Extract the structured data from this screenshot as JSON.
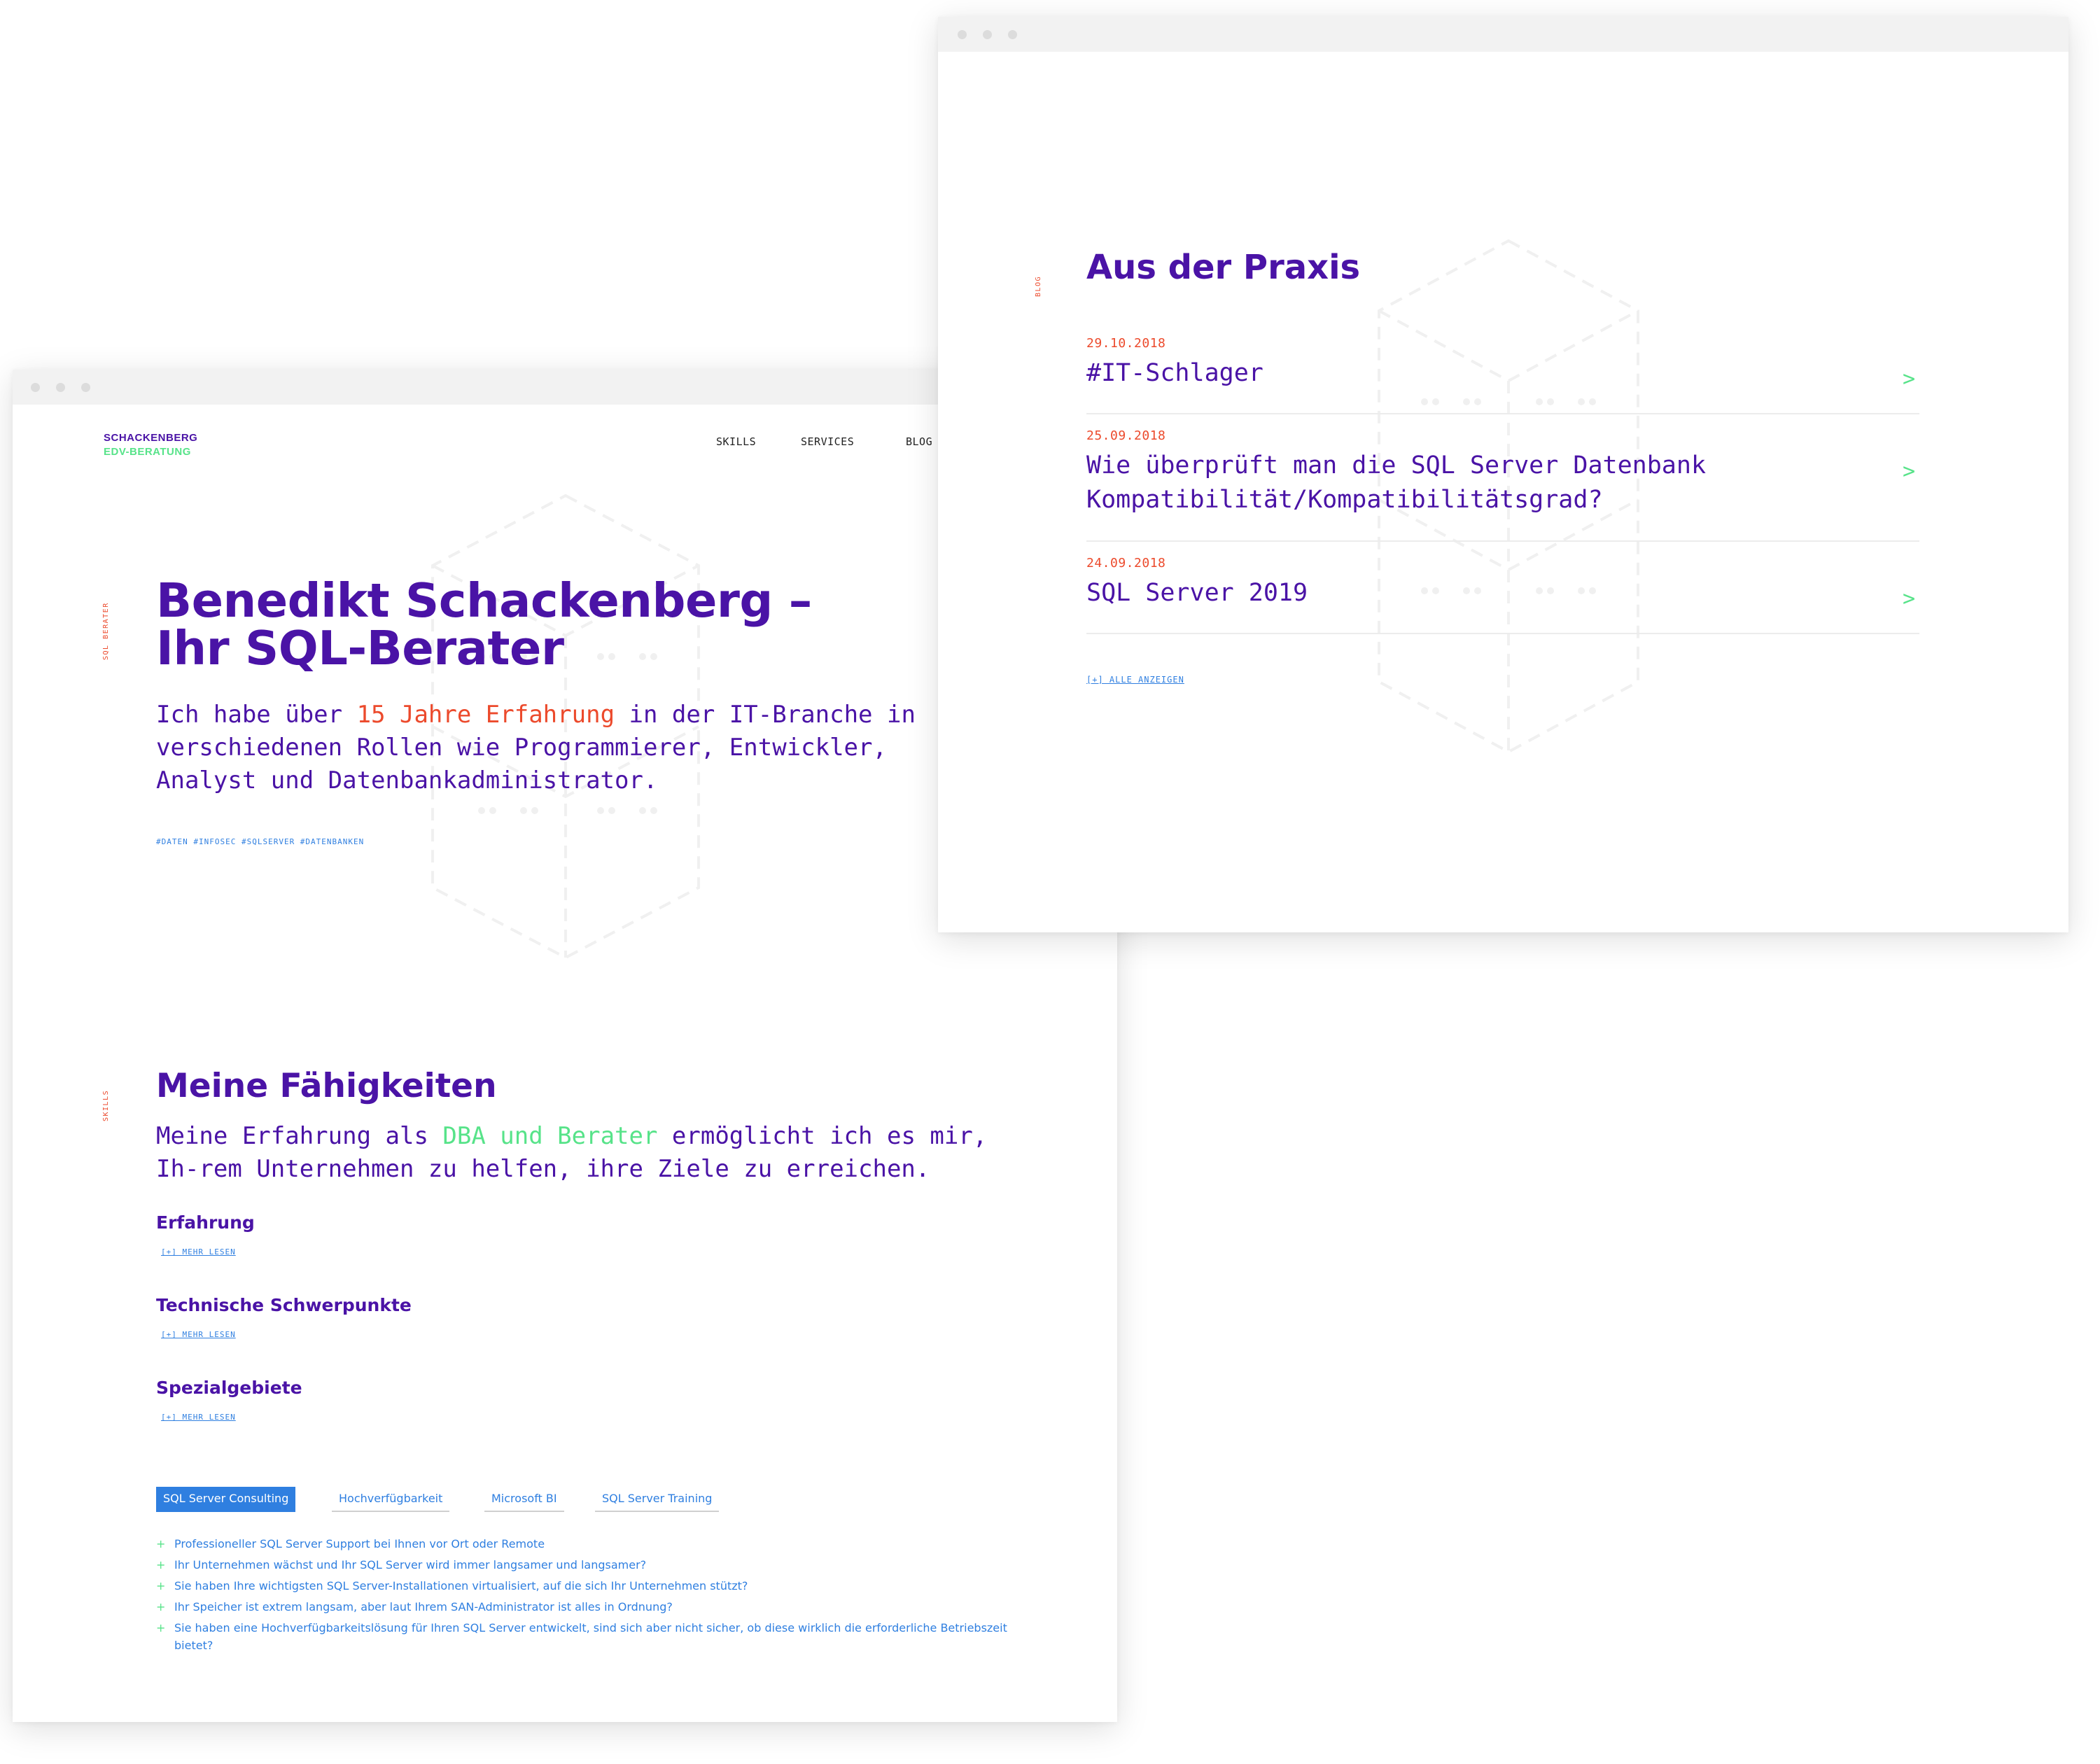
{
  "colors": {
    "purple": "#4a13a6",
    "red": "#ec4a2c",
    "green": "#57e389",
    "blue": "#2f7fe0"
  },
  "home": {
    "logo": {
      "line1": "SCHACKENBERG",
      "line2": "EDV-BERATUNG"
    },
    "nav": [
      "SKILLS",
      "SERVICES",
      "BLOG"
    ],
    "hero": {
      "side_label": "SQL BERATER",
      "title_line1": "Benedikt Schackenberg –",
      "title_line2": "Ihr SQL-Berater",
      "intro_before": "Ich habe über ",
      "intro_highlight": "15 Jahre Erfahrung",
      "intro_after": " in der IT-Branche in verschiedenen Rollen wie Programmierer, Entwickler, Analyst und Datenbankadministrator.",
      "tags": "#DATEN #INFOSEC #SQLSERVER #DATENBANKEN"
    },
    "skills": {
      "side_label": "SKILLS",
      "title": "Meine Fähigkeiten",
      "intro_before": "Meine Erfahrung als ",
      "intro_highlight": "DBA und Berater",
      "intro_after": " ermöglicht ich es mir, Ih-rem Unternehmen zu helfen, ihre Ziele zu erreichen.",
      "items": [
        {
          "title": "Erfahrung",
          "more": "[+] MEHR LESEN"
        },
        {
          "title": "Technische Schwerpunkte",
          "more": "[+] MEHR LESEN"
        },
        {
          "title": "Spezialgebiete",
          "more": "[+] MEHR LESEN"
        }
      ],
      "tabs": [
        {
          "label": "SQL Server Consulting",
          "active": true
        },
        {
          "label": "Hochverfügbarkeit",
          "active": false
        },
        {
          "label": "Microsoft BI",
          "active": false
        },
        {
          "label": "SQL Server Training",
          "active": false
        }
      ],
      "bullets": [
        "Professioneller SQL Server Support bei Ihnen vor Ort oder Remote",
        "Ihr Unternehmen wächst und Ihr SQL Server wird immer langsamer und langsamer?",
        "Sie haben Ihre wichtigsten SQL Server-Installationen virtualisiert, auf die sich Ihr Unternehmen stützt?",
        "Ihr Speicher ist extrem langsam, aber laut Ihrem SAN-Administrator ist alles in Ordnung?",
        "Sie haben eine Hochverfügbarkeitslösung für Ihren SQL Server entwickelt, sind sich aber nicht sicher, ob diese wirklich die erforderliche Betriebszeit bietet?"
      ],
      "bullet_marker": "+"
    }
  },
  "blog": {
    "side_label": "BLOG",
    "title": "Aus der Praxis",
    "posts": [
      {
        "date": "29.10.2018",
        "title": "#IT-Schlager"
      },
      {
        "date": "25.09.2018",
        "title": "Wie überprüft man die SQL Server Datenbank Kompatibilität/Kompatibilitätsgrad?"
      },
      {
        "date": "24.09.2018",
        "title": "SQL Server 2019"
      }
    ],
    "chevron": ">",
    "all_link": "[+] ALLE ANZEIGEN"
  }
}
